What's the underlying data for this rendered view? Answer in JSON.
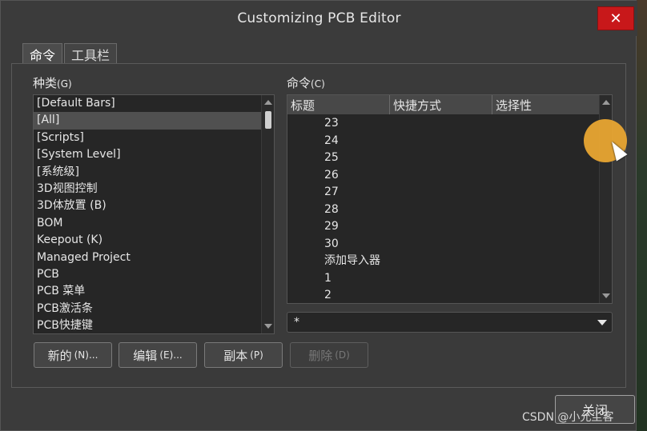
{
  "window": {
    "title": "Customizing PCB Editor",
    "close_glyph": "✕"
  },
  "tabs": [
    {
      "label": "命令"
    },
    {
      "label": "工具栏"
    }
  ],
  "categories": {
    "label": "种类",
    "accelerator": "(G)",
    "items": [
      "[Default Bars]",
      "[All]",
      "[Scripts]",
      "[System Level]",
      "[系统级]",
      "3D视图控制",
      "3D体放置 (B)",
      "BOM",
      "Keepout (K)",
      "Managed Project",
      "PCB",
      "PCB 菜单",
      "PCB激活条",
      "PCB快捷键"
    ],
    "selected_index": 1
  },
  "commands": {
    "label": "命令",
    "accelerator": "(C)",
    "columns": [
      "标题",
      "快捷方式",
      "选择性"
    ],
    "rows": [
      "23",
      "24",
      "25",
      "26",
      "27",
      "28",
      "29",
      "30",
      "添加导入器",
      "1",
      "2"
    ]
  },
  "filter": {
    "value": "*"
  },
  "buttons": {
    "new": {
      "label": "新的",
      "accel": "(N)..."
    },
    "edit": {
      "label": "编辑",
      "accel": "(E)..."
    },
    "copy": {
      "label": "副本",
      "accel": "(P)"
    },
    "delete": {
      "label": "删除",
      "accel": "(D)"
    }
  },
  "close_button": {
    "label": "关闭"
  },
  "watermark": "CSDN @小允尘客",
  "colors": {
    "close_red": "#c8181a",
    "cursor_highlight": "#e8a531"
  }
}
